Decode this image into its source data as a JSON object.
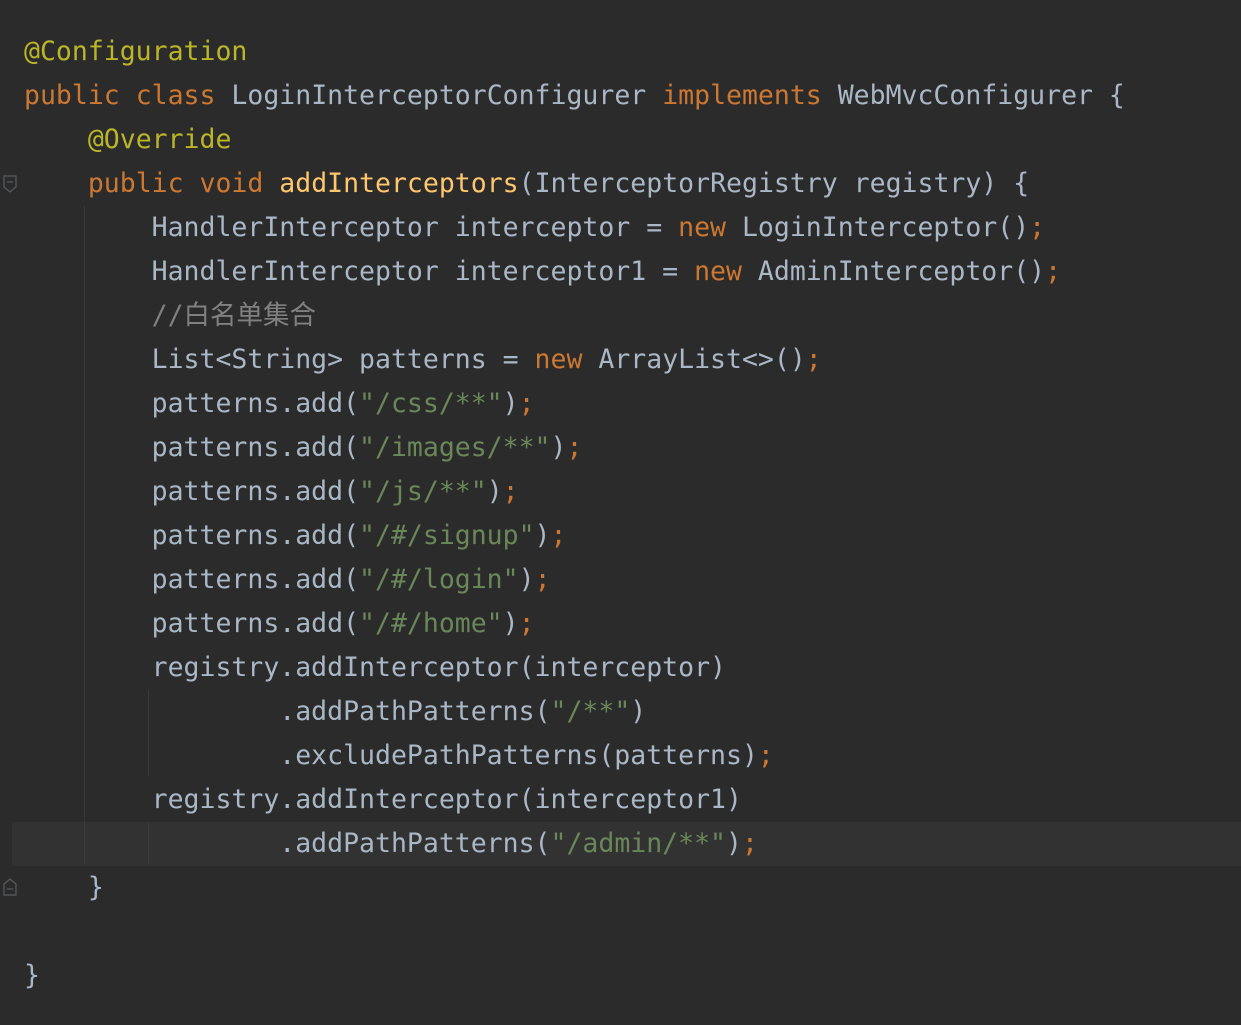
{
  "editor": {
    "theme_colors": {
      "background": "#2b2b2b",
      "annotation": "#bbb529",
      "keyword": "#cc7832",
      "method": "#ffc66d",
      "string": "#6a8759",
      "comment": "#808080",
      "text": "#a9b7c6",
      "current_line": "#323232"
    },
    "lines": [
      {
        "tokens": [
          {
            "t": "@Configuration",
            "c": "ann"
          }
        ]
      },
      {
        "tokens": [
          {
            "t": "public ",
            "c": "kw"
          },
          {
            "t": "class ",
            "c": "kw"
          },
          {
            "t": "LoginInterceptorConfigurer ",
            "c": "plain"
          },
          {
            "t": "implements ",
            "c": "kw"
          },
          {
            "t": "WebMvcConfigurer {",
            "c": "plain"
          }
        ]
      },
      {
        "tokens": [
          {
            "t": "    ",
            "c": "plain"
          },
          {
            "t": "@Override",
            "c": "ann"
          }
        ]
      },
      {
        "tokens": [
          {
            "t": "    ",
            "c": "plain"
          },
          {
            "t": "public ",
            "c": "kw"
          },
          {
            "t": "void ",
            "c": "kw"
          },
          {
            "t": "addInterceptors",
            "c": "fn"
          },
          {
            "t": "(InterceptorRegistry registry) {",
            "c": "plain"
          }
        ]
      },
      {
        "tokens": [
          {
            "t": "        HandlerInterceptor interceptor = ",
            "c": "plain"
          },
          {
            "t": "new ",
            "c": "kw"
          },
          {
            "t": "LoginInterceptor()",
            "c": "plain"
          },
          {
            "t": ";",
            "c": "punc"
          }
        ]
      },
      {
        "tokens": [
          {
            "t": "        HandlerInterceptor interceptor1 = ",
            "c": "plain"
          },
          {
            "t": "new ",
            "c": "kw"
          },
          {
            "t": "AdminInterceptor()",
            "c": "plain"
          },
          {
            "t": ";",
            "c": "punc"
          }
        ]
      },
      {
        "tokens": [
          {
            "t": "        ",
            "c": "plain"
          },
          {
            "t": "//白名单集合",
            "c": "cmt"
          }
        ]
      },
      {
        "tokens": [
          {
            "t": "        List<String> patterns = ",
            "c": "plain"
          },
          {
            "t": "new ",
            "c": "kw"
          },
          {
            "t": "ArrayList<>()",
            "c": "plain"
          },
          {
            "t": ";",
            "c": "punc"
          }
        ]
      },
      {
        "tokens": [
          {
            "t": "        patterns.add(",
            "c": "plain"
          },
          {
            "t": "\"/css/**\"",
            "c": "str"
          },
          {
            "t": ")",
            "c": "plain"
          },
          {
            "t": ";",
            "c": "punc"
          }
        ]
      },
      {
        "tokens": [
          {
            "t": "        patterns.add(",
            "c": "plain"
          },
          {
            "t": "\"/images/**\"",
            "c": "str"
          },
          {
            "t": ")",
            "c": "plain"
          },
          {
            "t": ";",
            "c": "punc"
          }
        ]
      },
      {
        "tokens": [
          {
            "t": "        patterns.add(",
            "c": "plain"
          },
          {
            "t": "\"/js/**\"",
            "c": "str"
          },
          {
            "t": ")",
            "c": "plain"
          },
          {
            "t": ";",
            "c": "punc"
          }
        ]
      },
      {
        "tokens": [
          {
            "t": "        patterns.add(",
            "c": "plain"
          },
          {
            "t": "\"/#/signup\"",
            "c": "str"
          },
          {
            "t": ")",
            "c": "plain"
          },
          {
            "t": ";",
            "c": "punc"
          }
        ]
      },
      {
        "tokens": [
          {
            "t": "        patterns.add(",
            "c": "plain"
          },
          {
            "t": "\"/#/login\"",
            "c": "str"
          },
          {
            "t": ")",
            "c": "plain"
          },
          {
            "t": ";",
            "c": "punc"
          }
        ]
      },
      {
        "tokens": [
          {
            "t": "        patterns.add(",
            "c": "plain"
          },
          {
            "t": "\"/#/home\"",
            "c": "str"
          },
          {
            "t": ")",
            "c": "plain"
          },
          {
            "t": ";",
            "c": "punc"
          }
        ]
      },
      {
        "tokens": [
          {
            "t": "        registry.addInterceptor(interceptor)",
            "c": "plain"
          }
        ]
      },
      {
        "tokens": [
          {
            "t": "                .addPathPatterns(",
            "c": "plain"
          },
          {
            "t": "\"/**\"",
            "c": "str"
          },
          {
            "t": ")",
            "c": "plain"
          }
        ]
      },
      {
        "tokens": [
          {
            "t": "                .excludePathPatterns(patterns)",
            "c": "plain"
          },
          {
            "t": ";",
            "c": "punc"
          }
        ]
      },
      {
        "tokens": [
          {
            "t": "        registry.addInterceptor(interceptor1)",
            "c": "plain"
          }
        ]
      },
      {
        "tokens": [
          {
            "t": "                .addPathPatterns(",
            "c": "plain"
          },
          {
            "t": "\"/admin/**\"",
            "c": "str"
          },
          {
            "t": ")",
            "c": "plain"
          },
          {
            "t": ";",
            "c": "punc"
          }
        ],
        "current": true
      },
      {
        "tokens": [
          {
            "t": "    }",
            "c": "plain"
          }
        ]
      },
      {
        "tokens": [
          {
            "t": "",
            "c": "plain"
          }
        ]
      },
      {
        "tokens": [
          {
            "t": "}",
            "c": "plain"
          }
        ]
      }
    ]
  }
}
